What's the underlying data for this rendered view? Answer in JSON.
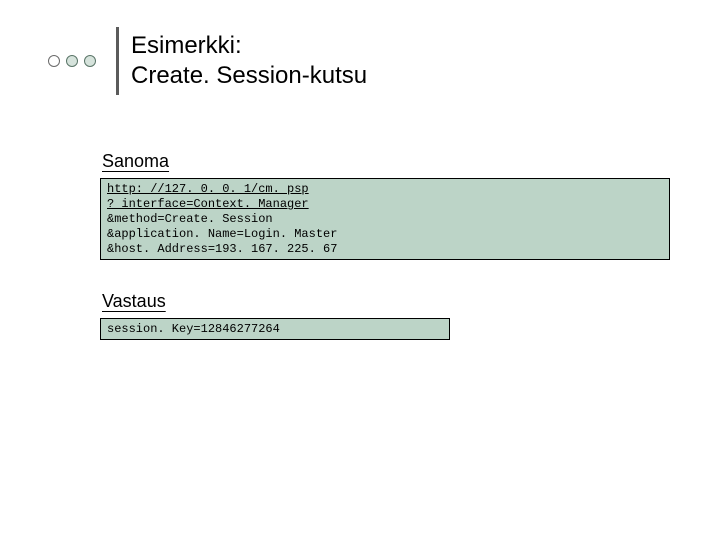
{
  "title": {
    "line1": "Esimerkki:",
    "line2": "Create. Session-kutsu"
  },
  "sections": {
    "sanoma": {
      "heading": "Sanoma",
      "code": {
        "line1": "http: //127. 0. 0. 1/cm. psp",
        "line2": "? interface=Context. Manager",
        "line3": "&method=Create. Session",
        "line4": "&application. Name=Login. Master",
        "line5": "&host. Address=193. 167. 225. 67"
      }
    },
    "vastaus": {
      "heading": "Vastaus",
      "code": {
        "line1": "session. Key=12846277264"
      }
    }
  }
}
